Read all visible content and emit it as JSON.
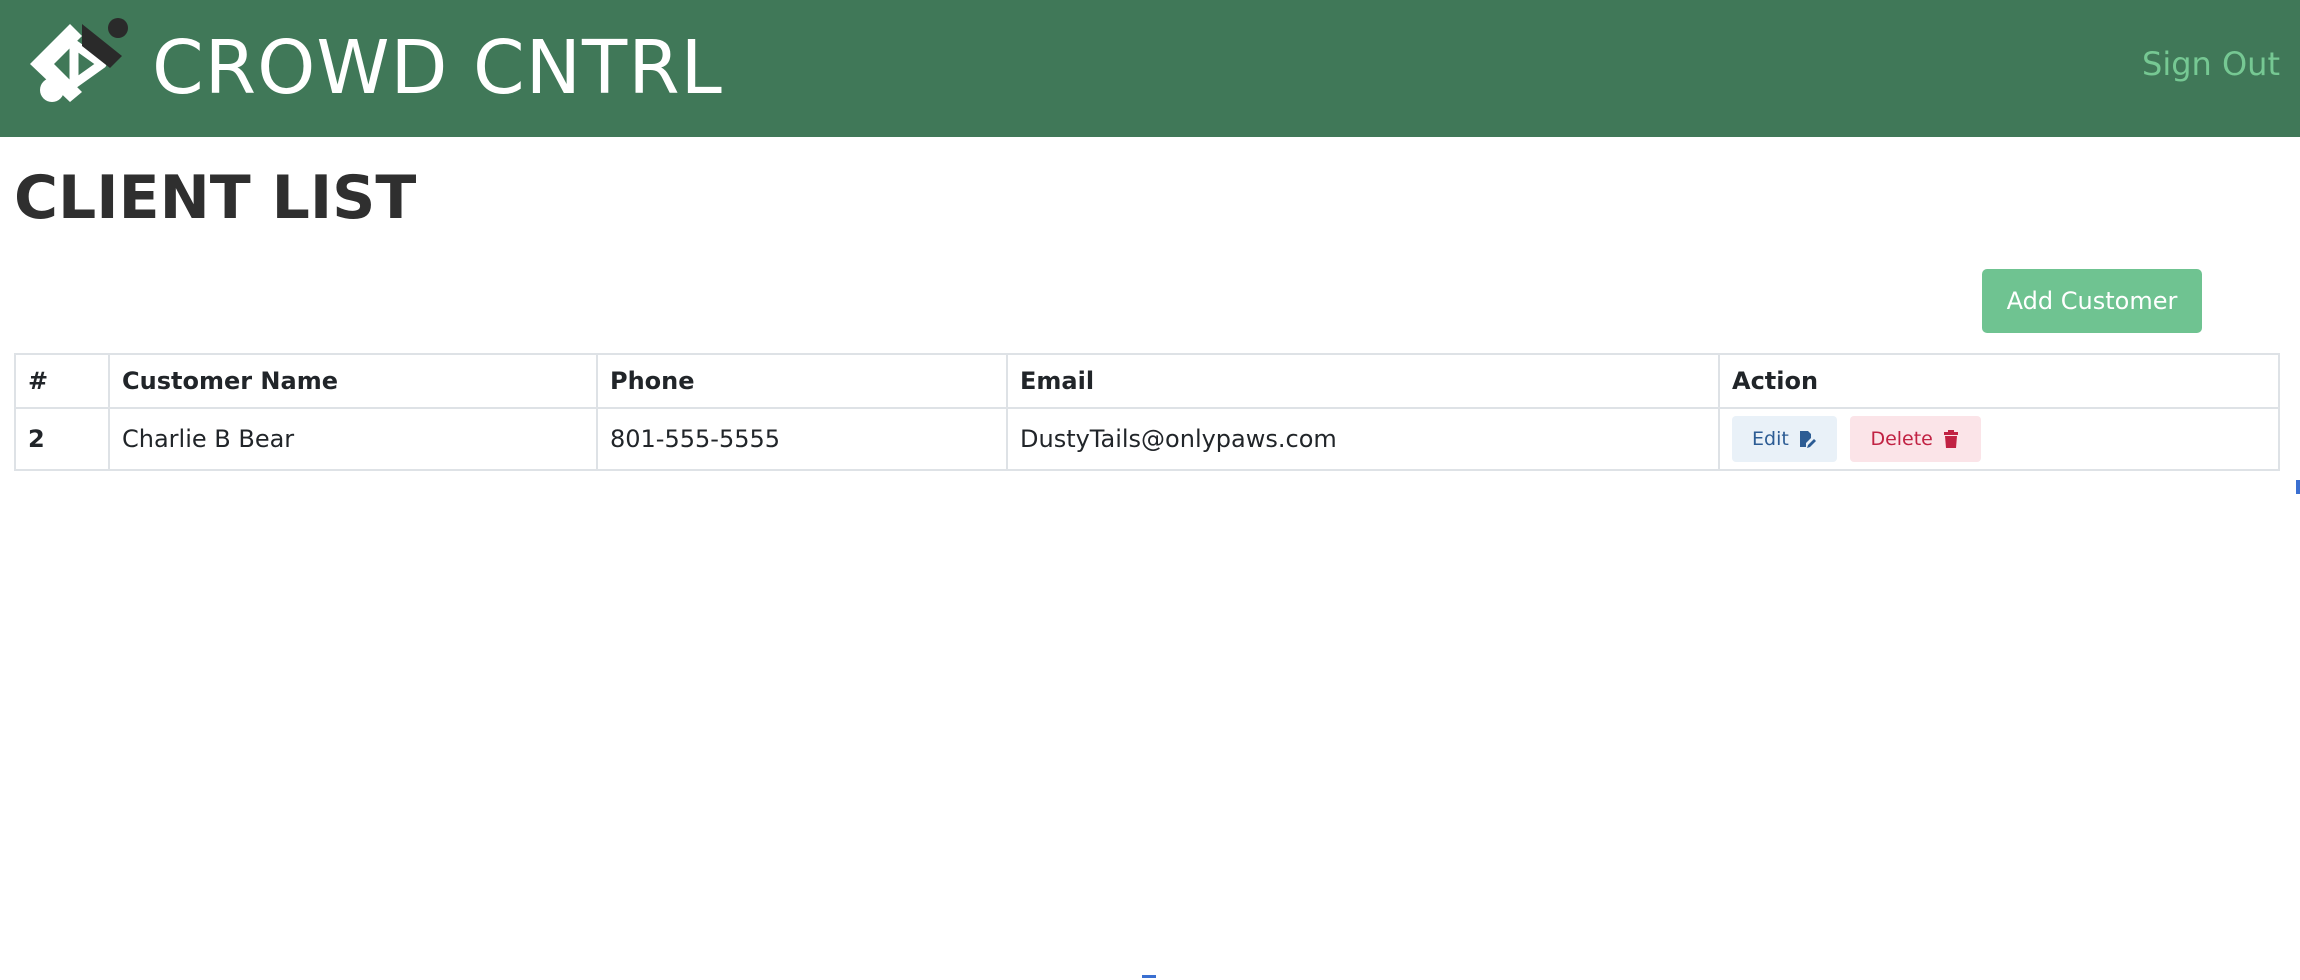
{
  "header": {
    "brand_name": "CROWD CNTRL",
    "sign_out_label": "Sign Out",
    "background_color": "#407858",
    "sign_out_color": "#76c893",
    "logo_icon": "crowd-cntrl-logo-icon"
  },
  "main": {
    "title": "CLIENT LIST",
    "add_customer_label": "Add Customer",
    "add_customer_color": "#6fc391"
  },
  "table": {
    "columns": [
      "#",
      "Customer Name",
      "Phone",
      "Email",
      "Action"
    ],
    "rows": [
      {
        "id": "2",
        "name": "Charlie B Bear",
        "phone": "801-555-5555",
        "email": "DustyTails@onlypaws.com",
        "edit_label": "Edit",
        "edit_icon": "edit-icon",
        "delete_label": "Delete",
        "delete_icon": "trash-icon"
      }
    ]
  }
}
